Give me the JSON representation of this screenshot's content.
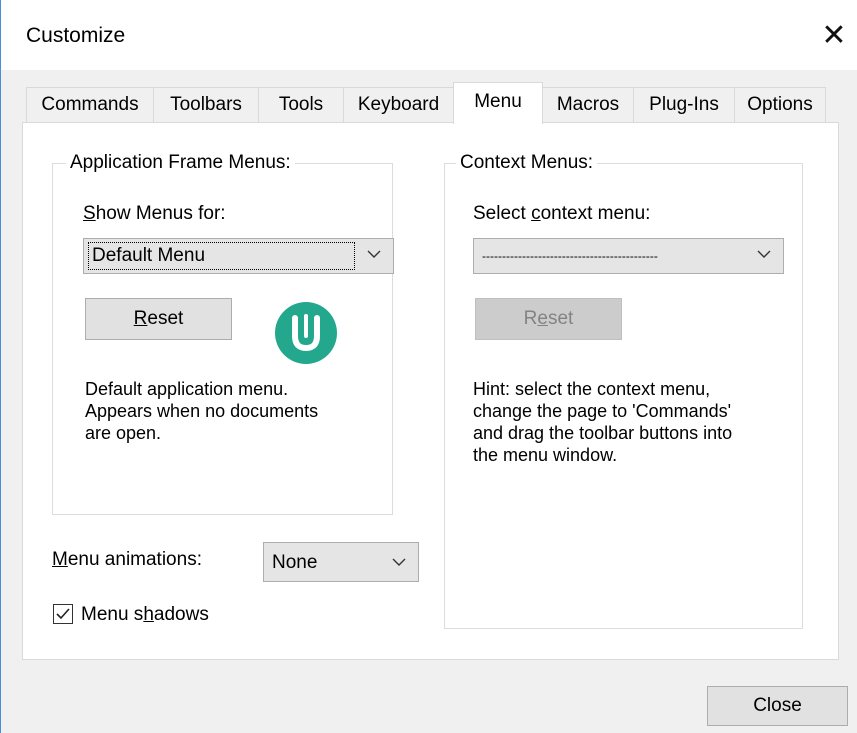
{
  "window": {
    "title": "Customize",
    "close_glyph": "✕"
  },
  "tabs": [
    {
      "label": "Commands"
    },
    {
      "label": "Toolbars"
    },
    {
      "label": "Tools"
    },
    {
      "label": "Keyboard"
    },
    {
      "label": "Menu"
    },
    {
      "label": "Macros"
    },
    {
      "label": "Plug-Ins"
    },
    {
      "label": "Options"
    }
  ],
  "active_tab": "Menu",
  "app_frame": {
    "group_label": "Application Frame Menus:",
    "show_for_label_u": "S",
    "show_for_label_rest": "how Menus for:",
    "selected": "Default Menu",
    "reset_u": "R",
    "reset_rest": "eset",
    "description_lines": [
      "Default application menu.",
      "Appears when no documents",
      "are open."
    ]
  },
  "context": {
    "group_label": "Context Menus:",
    "select_label_pre": "Select ",
    "select_label_u": "c",
    "select_label_post": "ontext menu:",
    "selected": "--------------------------------------------",
    "reset_pre": "R",
    "reset_u": "e",
    "reset_post": "set",
    "hint_lines": [
      "Hint: select the context menu,",
      "change the page to 'Commands'",
      "and drag the toolbar buttons into",
      "the menu window."
    ]
  },
  "menu_animations": {
    "label_u": "M",
    "label_rest": "enu animations:",
    "selected": "None"
  },
  "menu_shadows": {
    "label_pre": "Menu s",
    "label_u": "h",
    "label_post": "adows",
    "checked": true,
    "check_glyph": "✓"
  },
  "footer": {
    "close_label": "Close"
  },
  "colors": {
    "logo": "#23a88e",
    "window_border": "#4a90d9"
  },
  "icons": {
    "logo": "u-logo-icon",
    "dropdown": "chevron-down-icon",
    "close": "close-icon"
  }
}
